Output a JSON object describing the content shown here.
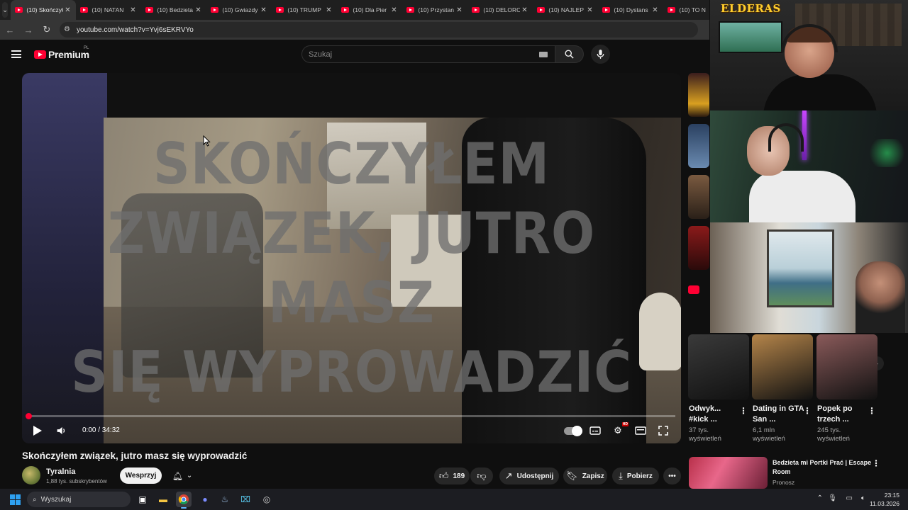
{
  "browser": {
    "tabs": [
      {
        "title": "(10) Skończyłe",
        "active": true
      },
      {
        "title": "(10) NATAN",
        "active": false
      },
      {
        "title": "(10) Bedzieta",
        "active": false
      },
      {
        "title": "(10) Gwiazdy",
        "active": false
      },
      {
        "title": "(10) TRUMP",
        "active": false
      },
      {
        "title": "(10) Dla Pier",
        "active": false
      },
      {
        "title": "(10) Przystan",
        "active": false
      },
      {
        "title": "(10) DELORO",
        "active": false
      },
      {
        "title": "(10) NAJLEP",
        "active": false
      },
      {
        "title": "(10) Dystans",
        "active": false
      },
      {
        "title": "(10) TO N",
        "active": false
      }
    ],
    "url": "youtube.com/watch?v=Yvj6sEKRVYo"
  },
  "header": {
    "logo_text": "Premium",
    "logo_country": "PL",
    "search_placeholder": "Szukaj"
  },
  "player": {
    "overlay_title": "SKOŃCZYŁEM\nZWIĄZEK, JUTRO MASZ\nSIĘ WYPROWADZIĆ",
    "time": "0:00 / 34:32",
    "progress_fraction": 0.0
  },
  "video": {
    "title": "Skończyłem związek, jutro masz się wyprowadzić",
    "channel_name": "Tyralnia",
    "subscribers": "1,88 tys. subskrybentów",
    "support_label": "Wesprzyj",
    "likes": "189",
    "share_label": "Udostępnij",
    "save_label": "Zapisz",
    "download_label": "Pobierz"
  },
  "shorts": [
    {
      "title": "Odwyk... #kick ...",
      "views": "37 tys. wyświetleń",
      "thumb_color": "#3a3a3a"
    },
    {
      "title": "Dating in GTA San ...",
      "views": "6,1 mln wyświetleń",
      "thumb_color": "#b5854a"
    },
    {
      "title": "Popek po trzech ...",
      "views": "245 tys. wyświetleń",
      "thumb_color": "#8a5a5a"
    }
  ],
  "recommended": {
    "title": "Bedzieta mi Portki Prać | Escape Room",
    "channel": "Pronosz"
  },
  "overlay": {
    "brand": "ELDERAS"
  },
  "taskbar": {
    "search_placeholder": "Wyszukaj",
    "time": "23:15",
    "date": "11.03.2026"
  },
  "colors": {
    "accent": "#ff0033",
    "background": "#0f0f0f",
    "pill": "#272727"
  }
}
